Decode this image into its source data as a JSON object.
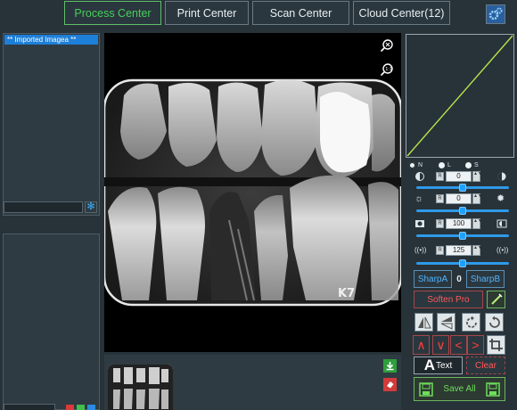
{
  "tabs": [
    {
      "label": "Process  Center",
      "active": true
    },
    {
      "label": "Print Center",
      "active": false
    },
    {
      "label": "Scan Center",
      "active": false
    },
    {
      "label": "Cloud Center(12)",
      "active": false
    }
  ],
  "left_panel": {
    "image_list": [
      "** Imported Imagea **"
    ]
  },
  "viewer": {
    "watermark": "K7"
  },
  "adjustments": {
    "mode_options": [
      "N",
      "L",
      "S"
    ],
    "selected_mode": "N",
    "brightness": {
      "value": "0",
      "level": 0.5
    },
    "contrast": {
      "value": "0",
      "level": 0.5
    },
    "gamma": {
      "value": "100",
      "level": 0.5
    },
    "sharpness": {
      "value": "125",
      "level": 0.5
    }
  },
  "filters": {
    "sharp_a_label": "SharpA",
    "sharp_value": "0",
    "sharp_b_label": "SharpB",
    "soften_label": "Soften Pro"
  },
  "arrows": [
    "∧",
    "∨",
    "<",
    ">"
  ],
  "actions": {
    "text_label": "Text",
    "clear_label": "Clear",
    "save_all_label": "Save All"
  },
  "colors": {
    "accent_green": "#46d05a",
    "accent_blue": "#4fb3ff",
    "accent_red": "#ff3c3c",
    "curve_line": "#b7e34a"
  }
}
